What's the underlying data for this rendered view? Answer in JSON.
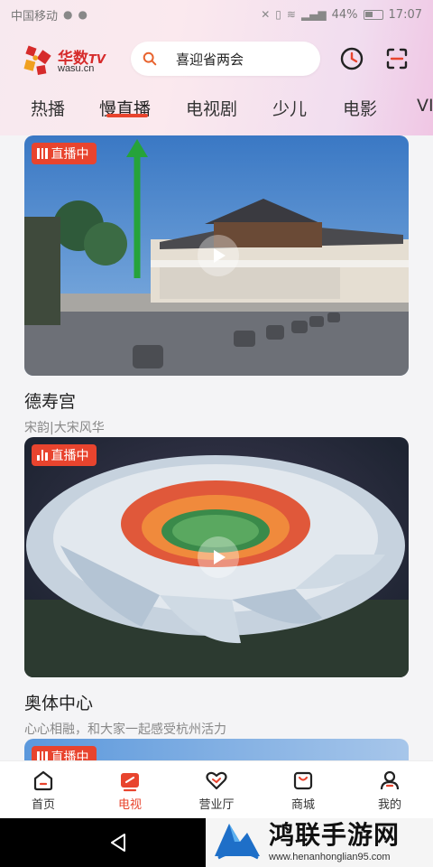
{
  "status_bar": {
    "carrier": "中国移动",
    "battery": "44%",
    "time": "17:07"
  },
  "header": {
    "logo_name": "华数",
    "logo_tv": "TV",
    "logo_domain": "wasu.cn",
    "search_text": "喜迎省两会"
  },
  "tabs": [
    {
      "label": "热播"
    },
    {
      "label": "慢直播",
      "active": true
    },
    {
      "label": "电视剧"
    },
    {
      "label": "少儿"
    },
    {
      "label": "电影"
    },
    {
      "label": "VI"
    }
  ],
  "cards": [
    {
      "badge": "直播中",
      "title": "德寿宫",
      "subtitle": "宋韵|大宋风华"
    },
    {
      "badge": "直播中",
      "title": "奥体中心",
      "subtitle": "心心相融，和大家一起感受杭州活力"
    },
    {
      "badge": "直播中"
    }
  ],
  "bottom_nav": [
    {
      "label": "首页",
      "icon": "home-icon"
    },
    {
      "label": "电视",
      "icon": "tv-icon",
      "active": true
    },
    {
      "label": "营业厅",
      "icon": "heart-icon"
    },
    {
      "label": "商城",
      "icon": "shop-icon"
    },
    {
      "label": "我的",
      "icon": "user-icon"
    }
  ],
  "watermark": {
    "title": "鸿联手游网",
    "url": "www.henanhonglian95.com"
  },
  "colors": {
    "accent": "#e8442e",
    "live_badge": "#e8442e"
  }
}
